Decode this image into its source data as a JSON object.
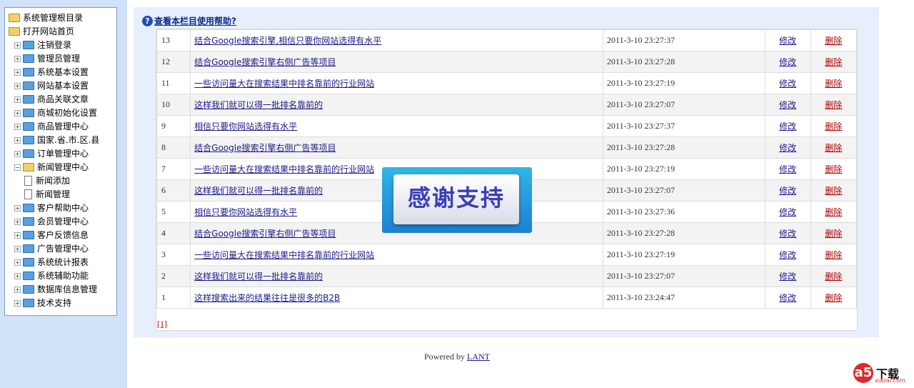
{
  "sidebar": {
    "items": [
      {
        "label": "系统管理根目录",
        "type": "root"
      },
      {
        "label": "打开网站首页",
        "type": "root"
      },
      {
        "label": "注销登录",
        "type": "folder"
      },
      {
        "label": "管理员管理",
        "type": "folder"
      },
      {
        "label": "系统基本设置",
        "type": "folder"
      },
      {
        "label": "网站基本设置",
        "type": "folder"
      },
      {
        "label": "商品关联文章",
        "type": "folder"
      },
      {
        "label": "商城初始化设置",
        "type": "folder"
      },
      {
        "label": "商品管理中心",
        "type": "folder"
      },
      {
        "label": "国家.省.市.区.县",
        "type": "folder"
      },
      {
        "label": "订单管理中心",
        "type": "folder"
      },
      {
        "label": "新闻管理中心",
        "type": "folder-open"
      },
      {
        "label": "新闻添加",
        "type": "page"
      },
      {
        "label": "新闻管理",
        "type": "page"
      },
      {
        "label": "客户帮助中心",
        "type": "folder"
      },
      {
        "label": "会员管理中心",
        "type": "folder"
      },
      {
        "label": "客户反馈信息",
        "type": "folder"
      },
      {
        "label": "广告管理中心",
        "type": "folder"
      },
      {
        "label": "系统统计报表",
        "type": "folder"
      },
      {
        "label": "系统辅助功能",
        "type": "folder"
      },
      {
        "label": "数据库信息管理",
        "type": "folder"
      },
      {
        "label": "技术支持",
        "type": "folder"
      }
    ]
  },
  "main": {
    "help_link": "查看本栏目使用帮助?",
    "edit_label": "修改",
    "delete_label": "删除",
    "rows": [
      {
        "id": "13",
        "title": "结合Google搜索引擎,相信只要你网站选得有水平",
        "time": "2011-3-10 23:27:37"
      },
      {
        "id": "12",
        "title": "结合Google搜索引擎右侧广告等项目",
        "time": "2011-3-10 23:27:28"
      },
      {
        "id": "11",
        "title": "一些访问量大在搜索结果中排名靠前的行业网站",
        "time": "2011-3-10 23:27:19"
      },
      {
        "id": "10",
        "title": "这样我们就可以得一批排名靠前的",
        "time": "2011-3-10 23:27:07"
      },
      {
        "id": "9",
        "title": "相信只要你网站选得有水平",
        "time": "2011-3-10 23:27:37"
      },
      {
        "id": "8",
        "title": "结合Google搜索引擎右侧广告等项目",
        "time": "2011-3-10 23:27:28"
      },
      {
        "id": "7",
        "title": "一些访问量大在搜索结果中排名靠前的行业网站",
        "time": "2011-3-10 23:27:19"
      },
      {
        "id": "6",
        "title": "这样我们就可以得一批排名靠前的",
        "time": "2011-3-10 23:27:07"
      },
      {
        "id": "5",
        "title": "相信只要你网站选得有水平",
        "time": "2011-3-10 23:27:36"
      },
      {
        "id": "4",
        "title": "结合Google搜索引擎右侧广告等项目",
        "time": "2011-3-10 23:27:28"
      },
      {
        "id": "3",
        "title": "一些访问量大在搜索结果中排名靠前的行业网站",
        "time": "2011-3-10 23:27:19"
      },
      {
        "id": "2",
        "title": "这样我们就可以得一批排名靠前的",
        "time": "2011-3-10 23:27:07"
      },
      {
        "id": "1",
        "title": "这样搜索出来的结果往往是很多的B2B",
        "time": "2011-3-10 23:24:47"
      }
    ],
    "pager": "[1]"
  },
  "footer": {
    "powered_by": "Powered by",
    "brand": "LANT"
  },
  "overlay": {
    "thanks": "感谢支持"
  },
  "watermark": {
    "logo": "a5",
    "text": "下载",
    "sub": "xiazai.com"
  }
}
